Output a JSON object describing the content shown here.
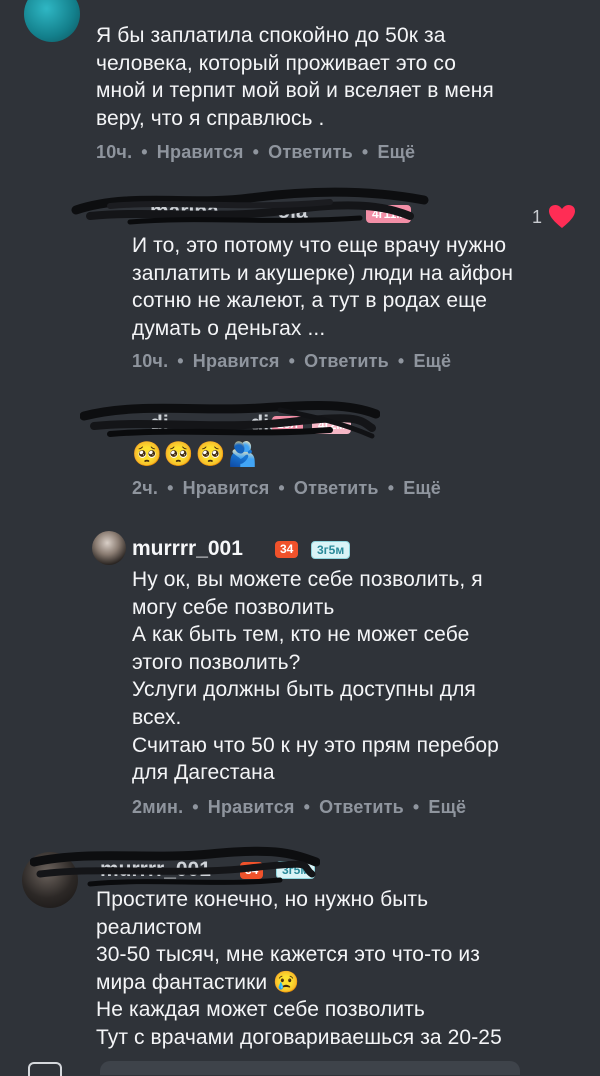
{
  "comments": [
    {
      "text": "Я бы заплатила спокойно до 50к за\nчеловека, который проживает это со\nмной и терпит мой вой и вселяет в меня\nверу, что я справлюсь .",
      "time": "10ч.",
      "like": "Нравится",
      "reply": "Ответить",
      "more": "Ещё"
    },
    {
      "username": "marina_____ola",
      "level": "4",
      "age": "4г11м",
      "likes": "1",
      "text": "И то, это потому что еще врачу нужно\nзаплатить и акушерке) люди на айфон\nсотню не жалеют, а тут в родах еще\nдумать о деньгах ...",
      "time": "10ч.",
      "like": "Нравится",
      "reply": "Ответить",
      "more": "Ещё"
    },
    {
      "username": "di_______dia",
      "level": "13л",
      "age": "4г2м",
      "text": "🥺🥺🥺🫂",
      "time": "2ч.",
      "like": "Нравится",
      "reply": "Ответить",
      "more": "Ещё"
    },
    {
      "username": "murrrr_001",
      "level": "34",
      "age": "3г5м",
      "text": "Ну ок, вы можете себе позволить, я\nмогу себе позволить\nА как быть тем, кто не может себе\nэтого позволить?\nУслуги должны быть доступны для\nвсех.\nСчитаю что 50 к ну это прям перебор\nдля Дагестана",
      "time": "2мин.",
      "like": "Нравится",
      "reply": "Ответить",
      "more": "Ещё"
    },
    {
      "username": "murrrr_001",
      "level": "34",
      "age": "3г5м",
      "text": "Простите конечно, но нужно быть\nреалистом\n30-50 тысяч, мне кажется это что-то из\nмира фантастики 😢\nНе каждая может себе позволить\nТут с врачами договариваешься за 20-25"
    }
  ],
  "colors": {
    "background": "#2f3339",
    "heart": "#ff2d55",
    "level_badge": "#f0522b"
  }
}
